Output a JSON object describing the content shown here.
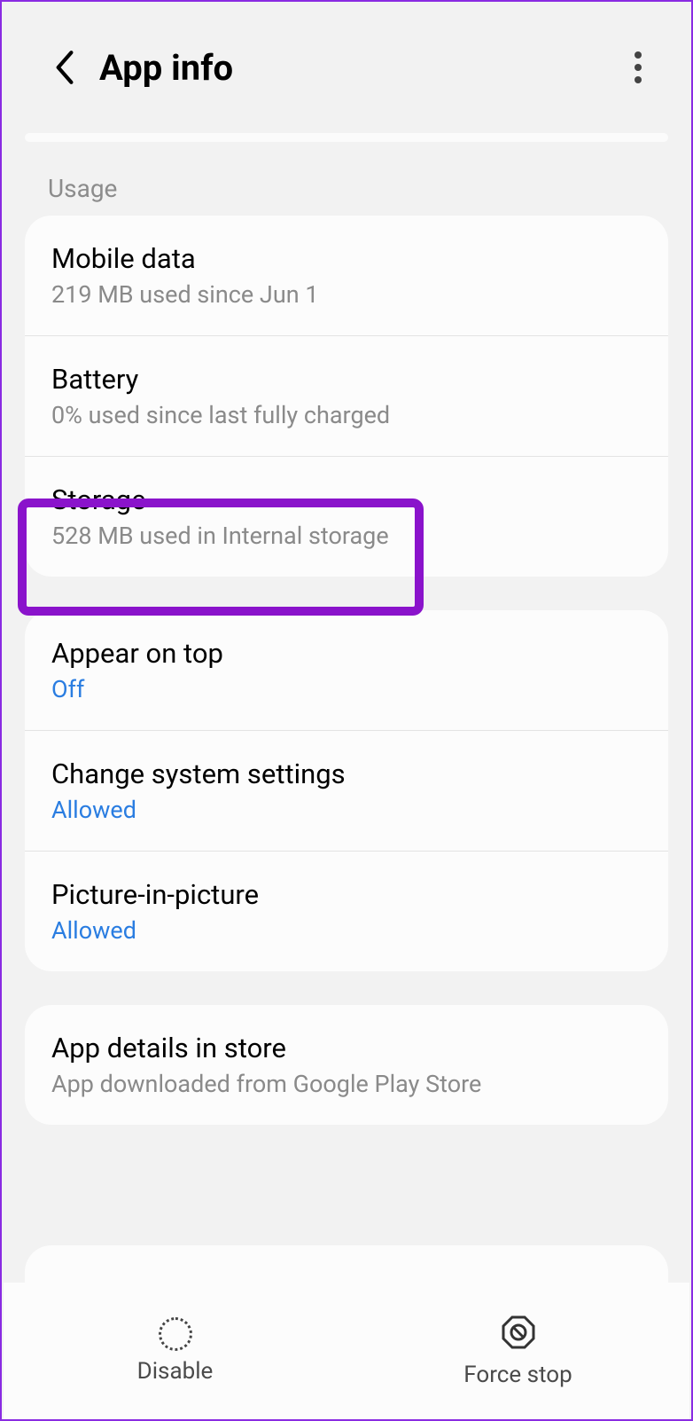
{
  "header": {
    "title": "App info"
  },
  "sections": {
    "usage_label": "Usage",
    "mobile_data": {
      "title": "Mobile data",
      "subtitle": "219 MB used since Jun 1"
    },
    "battery": {
      "title": "Battery",
      "subtitle": "0% used since last fully charged"
    },
    "storage": {
      "title": "Storage",
      "subtitle": "528 MB used in Internal storage"
    },
    "appear_on_top": {
      "title": "Appear on top",
      "status": "Off"
    },
    "change_system": {
      "title": "Change system settings",
      "status": "Allowed"
    },
    "pip": {
      "title": "Picture-in-picture",
      "status": "Allowed"
    },
    "app_details": {
      "title": "App details in store",
      "subtitle": "App downloaded from Google Play Store"
    }
  },
  "bottom": {
    "disable": "Disable",
    "force_stop": "Force stop"
  }
}
